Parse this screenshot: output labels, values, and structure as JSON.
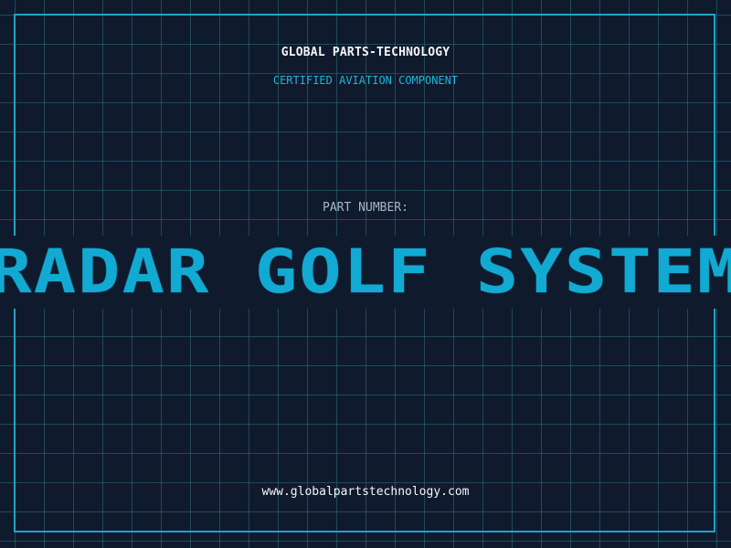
{
  "header": {
    "company_name": "GLOBAL PARTS-TECHNOLOGY",
    "certification": "CERTIFIED AVIATION COMPONENT"
  },
  "part": {
    "label": "PART NUMBER:",
    "name": "RADAR GOLF SYSTEM"
  },
  "footer": {
    "website": "www.globalpartstechnology.com"
  },
  "colors": {
    "background": "#101a2d",
    "grid": "#2f6e82",
    "accent": "#12aad3",
    "text": "#f4f6f8",
    "muted_text": "#a9b6c4"
  }
}
